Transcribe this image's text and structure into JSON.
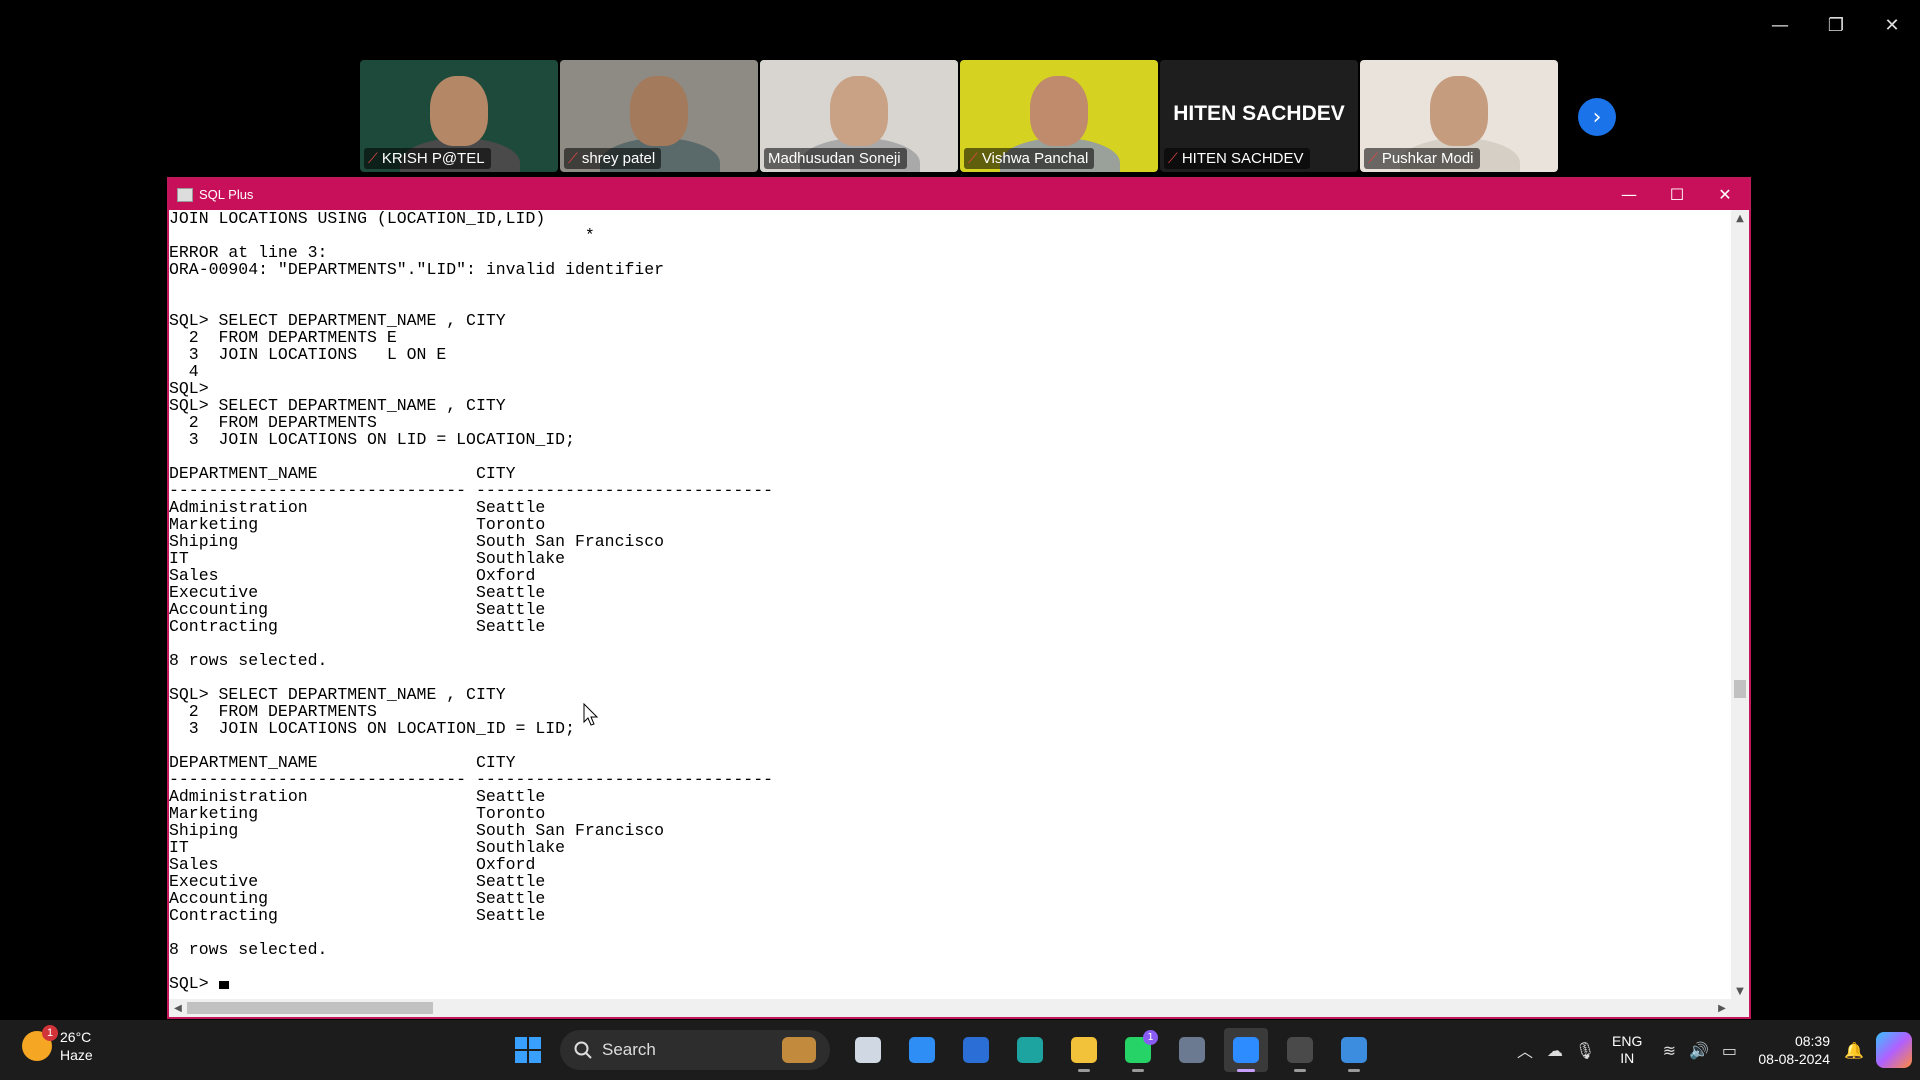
{
  "app_window": {
    "controls": [
      "—",
      "❐",
      "✕"
    ]
  },
  "participants": [
    {
      "name": "KRISH P@TEL",
      "muted": true,
      "bg": "#1d4a3a",
      "face": "#b48867",
      "body": "#4a4a4a",
      "show_video": true
    },
    {
      "name": "shrey patel",
      "muted": true,
      "bg": "#8e8a84",
      "face": "#a47a5c",
      "body": "#5a6a6a",
      "show_video": true
    },
    {
      "name": "Madhusudan Soneji",
      "muted": false,
      "bg": "#d8d5d0",
      "face": "#c9a184",
      "body": "#a9a9a9",
      "show_video": true,
      "active": true
    },
    {
      "name": "Vishwa Panchal",
      "muted": true,
      "bg": "#d6d221",
      "face": "#c08a6c",
      "body": "#9aa09a",
      "show_video": true
    },
    {
      "name": "HITEN SACHDEV",
      "muted": true,
      "bg": "#1e1e1e",
      "show_video": false,
      "big_name": "HITEN SACHDEV"
    },
    {
      "name": "Pushkar Modi",
      "muted": true,
      "bg": "#e9e3db",
      "face": "#c69c7f",
      "body": "#d5cfc5",
      "show_video": true
    }
  ],
  "next_icon": "›",
  "sqlplus": {
    "title": "SQL Plus",
    "controls": [
      "—",
      "☐",
      "✕"
    ],
    "console_text": "JOIN LOCATIONS USING (LOCATION_ID,LID)\n                                          *\nERROR at line 3:\nORA-00904: \"DEPARTMENTS\".\"LID\": invalid identifier\n\n\nSQL> SELECT DEPARTMENT_NAME , CITY\n  2  FROM DEPARTMENTS E\n  3  JOIN LOCATIONS   L ON E\n  4\nSQL>\nSQL> SELECT DEPARTMENT_NAME , CITY\n  2  FROM DEPARTMENTS\n  3  JOIN LOCATIONS ON LID = LOCATION_ID;\n\nDEPARTMENT_NAME                CITY\n------------------------------ ------------------------------\nAdministration                 Seattle\nMarketing                      Toronto\nShiping                        South San Francisco\nIT                             Southlake\nSales                          Oxford\nExecutive                      Seattle\nAccounting                     Seattle\nContracting                    Seattle\n\n8 rows selected.\n\nSQL> SELECT DEPARTMENT_NAME , CITY\n  2  FROM DEPARTMENTS\n  3  JOIN LOCATIONS ON LOCATION_ID = LID;\n\nDEPARTMENT_NAME                CITY\n------------------------------ ------------------------------\nAdministration                 Seattle\nMarketing                      Toronto\nShiping                        South San Francisco\nIT                             Southlake\nSales                          Oxford\nExecutive                      Seattle\nAccounting                     Seattle\nContracting                    Seattle\n\n8 rows selected.\n\n",
    "prompt": "SQL> "
  },
  "taskbar": {
    "weather": {
      "temp": "26°C",
      "condition": "Haze",
      "badge": "1"
    },
    "search_placeholder": "Search",
    "apps": [
      {
        "name": "task-view-icon",
        "color": "#cfd8e3",
        "running": false
      },
      {
        "name": "safari-icon",
        "color": "#2f8ef5",
        "running": false
      },
      {
        "name": "store-icon",
        "color": "#2b6fd6",
        "running": false
      },
      {
        "name": "edge-icon",
        "color": "#1ea4a0",
        "running": false
      },
      {
        "name": "file-explorer-icon",
        "color": "#f3c23b",
        "running": true
      },
      {
        "name": "whatsapp-icon",
        "color": "#25d366",
        "running": true,
        "badge": "1"
      },
      {
        "name": "sql-developer-icon",
        "color": "#6b7a90",
        "running": false
      },
      {
        "name": "zoom-icon",
        "color": "#2d8cff",
        "running": true,
        "active": true
      },
      {
        "name": "terminal-icon",
        "color": "#4a4a4a",
        "running": true
      },
      {
        "name": "paint-icon",
        "color": "#3c8de0",
        "running": true
      }
    ],
    "lang_top": "ENG",
    "lang_bottom": "IN",
    "time": "08:39",
    "date": "08-08-2024"
  }
}
